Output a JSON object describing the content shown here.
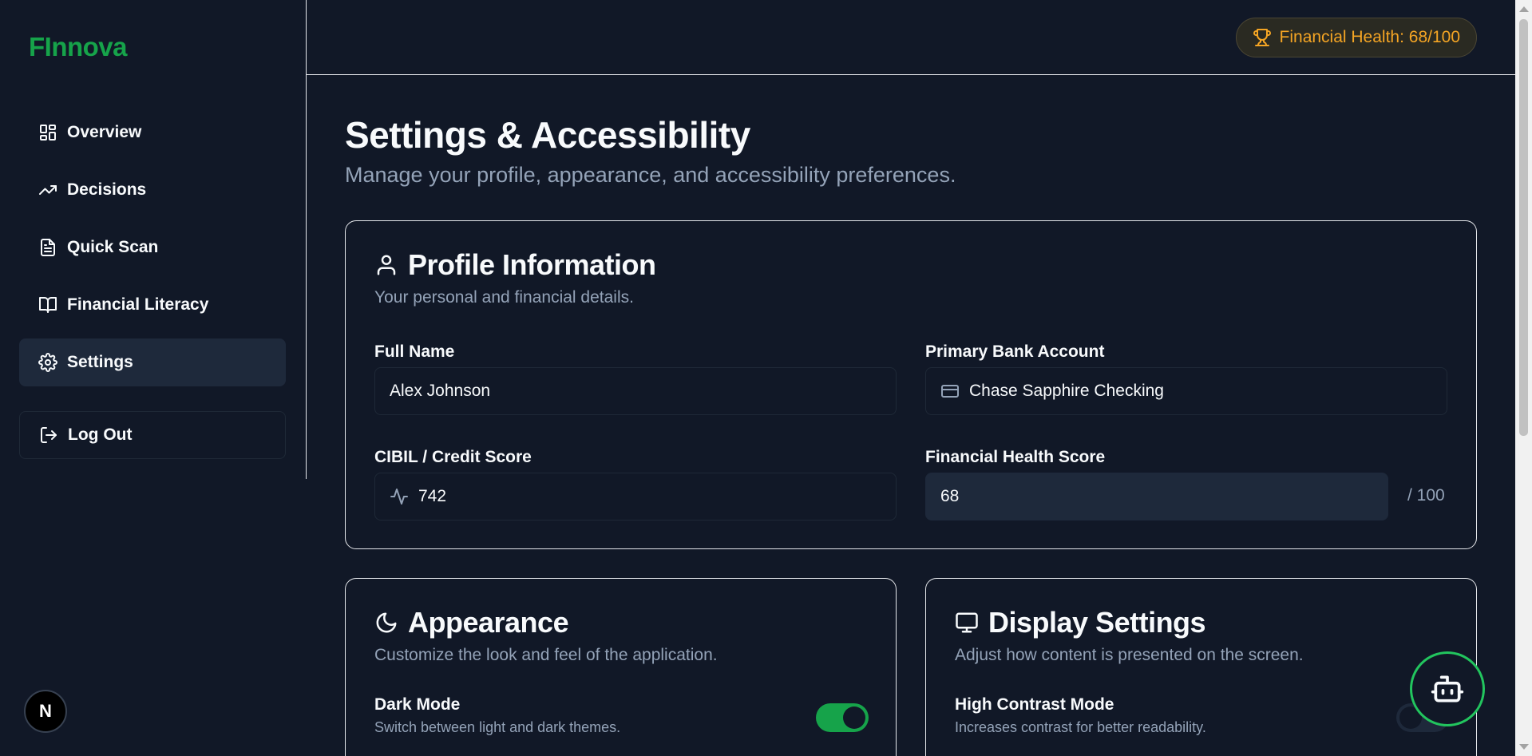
{
  "brand": {
    "logo": "FInnova"
  },
  "sidebar": {
    "items": [
      {
        "label": "Overview",
        "icon": "layout-grid-icon"
      },
      {
        "label": "Decisions",
        "icon": "trending-up-icon"
      },
      {
        "label": "Quick Scan",
        "icon": "file-text-icon"
      },
      {
        "label": "Financial Literacy",
        "icon": "book-open-icon"
      },
      {
        "label": "Settings",
        "icon": "gear-icon",
        "active": true
      }
    ],
    "logout_label": "Log Out"
  },
  "header": {
    "health_badge": "Financial Health: 68/100"
  },
  "page": {
    "title": "Settings & Accessibility",
    "subtitle": "Manage your profile, appearance, and accessibility preferences."
  },
  "profile": {
    "title": "Profile Information",
    "description": "Your personal and financial details.",
    "full_name_label": "Full Name",
    "full_name_value": "Alex Johnson",
    "bank_label": "Primary Bank Account",
    "bank_value": "Chase Sapphire Checking",
    "credit_label": "CIBIL / Credit Score",
    "credit_value": "742",
    "health_label": "Financial Health Score",
    "health_value": "68",
    "health_suffix": "/ 100"
  },
  "appearance": {
    "title": "Appearance",
    "description": "Customize the look and feel of the application.",
    "dark_mode_label": "Dark Mode",
    "dark_mode_desc": "Switch between light and dark themes.",
    "dark_mode_on": true
  },
  "display": {
    "title": "Display Settings",
    "description": "Adjust how content is presented on the screen.",
    "high_contrast_label": "High Contrast Mode",
    "high_contrast_desc": "Increases contrast for better readability.",
    "high_contrast_on": false
  },
  "misc": {
    "n_badge": "N"
  },
  "colors": {
    "background": "#111827",
    "accent": "#16a34a",
    "badge_text": "#f5a524",
    "muted": "#94a3b8"
  }
}
